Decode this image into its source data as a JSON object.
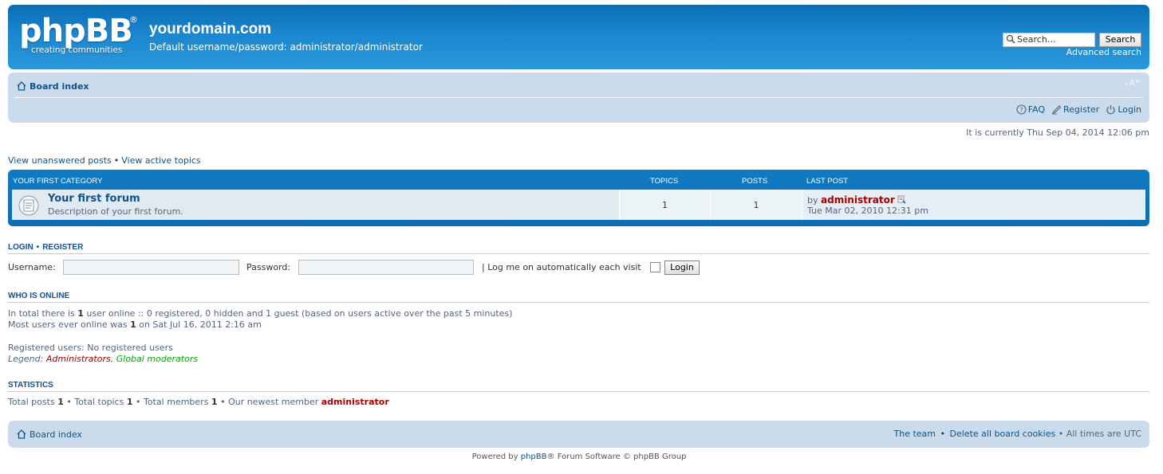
{
  "header": {
    "logo_main": "phpBB",
    "logo_reg": "®",
    "logo_sub": "creating  communities",
    "site_title": "yourdomain.com",
    "site_desc": "Default username/password: administrator/administrator",
    "search_placeholder": "Search…",
    "search_button": "Search",
    "advanced_search": "Advanced search"
  },
  "navbar": {
    "breadcrumb": "Board index",
    "font_size_control": "ᵥAᴬ",
    "links": {
      "faq": "FAQ",
      "register": "Register",
      "login": "Login"
    }
  },
  "current_time": "It is currently Thu Sep 04, 2014 12:06 pm",
  "quick_links": {
    "unanswered": "View unanswered posts",
    "separator": "•",
    "active": "View active topics"
  },
  "forum_table": {
    "category": "YOUR FIRST CATEGORY",
    "col_topics": "TOPICS",
    "col_posts": "POSTS",
    "col_last_post": "LAST POST",
    "rows": [
      {
        "name": "Your first forum",
        "description": "Description of your first forum.",
        "topics": "1",
        "posts": "1",
        "last_post_by": "by",
        "last_post_user": "administrator",
        "last_post_time": "Tue Mar 02, 2010 12:31 pm"
      }
    ]
  },
  "login_section": {
    "heading_login": "LOGIN",
    "heading_sep": "•",
    "heading_register": "REGISTER",
    "username_label": "Username:",
    "password_label": "Password:",
    "autologin_label": "| Log me on automatically each visit",
    "login_button": "Login"
  },
  "online_section": {
    "heading": "WHO IS ONLINE",
    "line1_pre": "In total there is",
    "line1_count": "1",
    "line1_post": "user online :: 0 registered, 0 hidden and 1 guest (based on users active over the past 5 minutes)",
    "line2_pre": "Most users ever online was",
    "line2_count": "1",
    "line2_post": "on Sat Jul 16, 2011 2:16 am",
    "registered": "Registered users: No registered users",
    "legend_label": "Legend:",
    "legend_admins": "Administrators",
    "legend_comma": ",",
    "legend_gmods": "Global moderators"
  },
  "stats_section": {
    "heading": "STATISTICS",
    "posts_label": "Total posts",
    "posts": "1",
    "topics_label": "• Total topics",
    "topics": "1",
    "members_label": "• Total members",
    "members": "1",
    "newest_label": "• Our newest member",
    "newest": "administrator"
  },
  "footer": {
    "breadcrumb": "Board index",
    "team": "The team",
    "sep": "•",
    "delete_cookies": "Delete all board cookies",
    "timezone": "• All times are UTC",
    "powered_pre": "Powered by",
    "powered_link": "phpBB",
    "powered_post": "® Forum Software © phpBB Group"
  },
  "colors": {
    "header_blue": "#0f6cb2",
    "nav_bg": "#cadceb",
    "link": "#105289",
    "admin_red": "#aa0000",
    "gmod_green": "#00aa00"
  }
}
